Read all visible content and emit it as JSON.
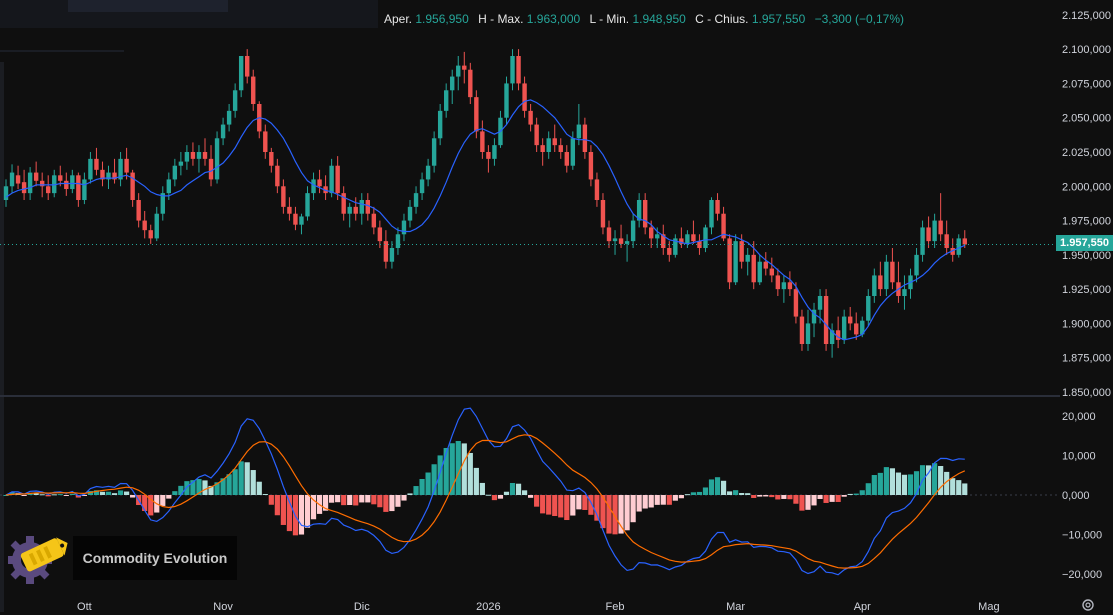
{
  "header": {
    "open_label": "Aper.",
    "open_value": "1.956,950",
    "high_label": "H - Max.",
    "high_value": "1.963,000",
    "low_label": "L - Min.",
    "low_value": "1.948,950",
    "close_label": "C - Chius.",
    "close_value": "1.957,550",
    "change_value": "−3,300 (−0,17%)"
  },
  "brand": {
    "name": "Commodity Evolution"
  },
  "last_price_label": "1.957,550",
  "colors": {
    "background": "#0f0f0f",
    "up": "#26a69a",
    "down": "#ef5350",
    "ma": "#2962ff",
    "macd": "#2962ff",
    "signal": "#ff6d00",
    "hist_up_strong": "#26a69a",
    "hist_up_weak": "#b2dfdb",
    "hist_down_strong": "#ef5350",
    "hist_down_weak": "#ffcdd2",
    "text": "#d1d4dc",
    "grid": "#2a2e39"
  },
  "icons": {
    "logo": "commodity-tag-gear-icon",
    "settings": "gear-icon"
  },
  "chart_data": [
    {
      "type": "candlestick",
      "y_ticks": [
        "2.125,000",
        "2.100,000",
        "2.075,000",
        "2.050,000",
        "2.025,000",
        "2.000,000",
        "1.975,000",
        "1.950,000",
        "1.925,000",
        "1.900,000",
        "1.875,000",
        "1.850,000"
      ],
      "ylim": [
        1850,
        2130
      ],
      "x_ticks": [
        "Ott",
        "Nov",
        "Dic",
        "2026",
        "Feb",
        "Mar",
        "Apr",
        "Mag"
      ],
      "x_tick_index": [
        13,
        36,
        59,
        80,
        101,
        121,
        142,
        163
      ],
      "last_price": 1957.55,
      "candles": [
        [
          1990,
          2005,
          1985,
          2000
        ],
        [
          2000,
          2016,
          1995,
          2010
        ],
        [
          2008,
          2015,
          1998,
          2002
        ],
        [
          2003,
          2012,
          1990,
          1995
        ],
        [
          1995,
          2014,
          1990,
          2010
        ],
        [
          2010,
          2018,
          2000,
          2004
        ],
        [
          2004,
          2010,
          1992,
          2000
        ],
        [
          2000,
          2008,
          1990,
          1995
        ],
        [
          1995,
          2012,
          1992,
          2008
        ],
        [
          2008,
          2015,
          2000,
          2004
        ],
        [
          2004,
          2010,
          1993,
          1998
        ],
        [
          1998,
          2012,
          1995,
          2008
        ],
        [
          2008,
          2010,
          1985,
          1990
        ],
        [
          1990,
          2010,
          1987,
          2005
        ],
        [
          2005,
          2025,
          2002,
          2020
        ],
        [
          2020,
          2028,
          2008,
          2012
        ],
        [
          2012,
          2018,
          2000,
          2005
        ],
        [
          2005,
          2015,
          1998,
          2010
        ],
        [
          2010,
          2020,
          2002,
          2005
        ],
        [
          2005,
          2025,
          2000,
          2020
        ],
        [
          2020,
          2028,
          2005,
          2010
        ],
        [
          2010,
          2012,
          1985,
          1990
        ],
        [
          1990,
          1995,
          1970,
          1975
        ],
        [
          1975,
          1982,
          1962,
          1968
        ],
        [
          1968,
          1972,
          1958,
          1962
        ],
        [
          1962,
          1985,
          1960,
          1980
        ],
        [
          1980,
          2000,
          1975,
          1995
        ],
        [
          1995,
          2010,
          1990,
          2005
        ],
        [
          2005,
          2020,
          2000,
          2015
        ],
        [
          2015,
          2025,
          2008,
          2018
        ],
        [
          2018,
          2030,
          2012,
          2025
        ],
        [
          2025,
          2032,
          2015,
          2020
        ],
        [
          2020,
          2030,
          2010,
          2025
        ],
        [
          2025,
          2035,
          2015,
          2020
        ],
        [
          2020,
          2030,
          2000,
          2005
        ],
        [
          2005,
          2040,
          2002,
          2035
        ],
        [
          2035,
          2050,
          2030,
          2045
        ],
        [
          2045,
          2060,
          2040,
          2055
        ],
        [
          2055,
          2075,
          2050,
          2070
        ],
        [
          2070,
          2090,
          2065,
          2095
        ],
        [
          2095,
          2100,
          2075,
          2080
        ],
        [
          2080,
          2085,
          2055,
          2060
        ],
        [
          2060,
          2062,
          2035,
          2040
        ],
        [
          2040,
          2045,
          2020,
          2025
        ],
        [
          2025,
          2028,
          2010,
          2015
        ],
        [
          2015,
          2020,
          1995,
          2000
        ],
        [
          2000,
          2005,
          1980,
          1985
        ],
        [
          1985,
          1992,
          1975,
          1980
        ],
        [
          1980,
          1985,
          1968,
          1972
        ],
        [
          1972,
          1980,
          1965,
          1978
        ],
        [
          1978,
          2000,
          1975,
          1995
        ],
        [
          1995,
          2010,
          1990,
          2005
        ],
        [
          2005,
          2012,
          1995,
          2000
        ],
        [
          2000,
          2008,
          1990,
          1995
        ],
        [
          1995,
          2020,
          1992,
          2015
        ],
        [
          2015,
          2022,
          1990,
          1995
        ],
        [
          1995,
          2000,
          1975,
          1980
        ],
        [
          1980,
          1988,
          1970,
          1985
        ],
        [
          1985,
          1992,
          1975,
          1980
        ],
        [
          1980,
          1995,
          1972,
          1990
        ],
        [
          1990,
          1995,
          1975,
          1980
        ],
        [
          1980,
          1985,
          1965,
          1970
        ],
        [
          1970,
          1975,
          1955,
          1960
        ],
        [
          1960,
          1968,
          1940,
          1945
        ],
        [
          1945,
          1960,
          1940,
          1955
        ],
        [
          1955,
          1970,
          1950,
          1965
        ],
        [
          1965,
          1980,
          1960,
          1975
        ],
        [
          1975,
          1990,
          1970,
          1985
        ],
        [
          1985,
          2000,
          1980,
          1995
        ],
        [
          1995,
          2010,
          1990,
          2005
        ],
        [
          2005,
          2020,
          2000,
          2015
        ],
        [
          2015,
          2040,
          2010,
          2035
        ],
        [
          2035,
          2060,
          2030,
          2055
        ],
        [
          2055,
          2075,
          2050,
          2070
        ],
        [
          2070,
          2085,
          2060,
          2080
        ],
        [
          2080,
          2095,
          2070,
          2088
        ],
        [
          2088,
          2098,
          2075,
          2085
        ],
        [
          2085,
          2090,
          2060,
          2065
        ],
        [
          2065,
          2070,
          2035,
          2040
        ],
        [
          2040,
          2048,
          2020,
          2025
        ],
        [
          2025,
          2030,
          2010,
          2020
        ],
        [
          2020,
          2035,
          2015,
          2030
        ],
        [
          2030,
          2055,
          2028,
          2050
        ],
        [
          2050,
          2080,
          2045,
          2075
        ],
        [
          2075,
          2100,
          2070,
          2095
        ],
        [
          2095,
          2100,
          2070,
          2075
        ],
        [
          2075,
          2080,
          2050,
          2055
        ],
        [
          2055,
          2060,
          2040,
          2045
        ],
        [
          2045,
          2050,
          2025,
          2030
        ],
        [
          2030,
          2035,
          2015,
          2025
        ],
        [
          2025,
          2040,
          2020,
          2035
        ],
        [
          2035,
          2045,
          2025,
          2030
        ],
        [
          2030,
          2035,
          2020,
          2025
        ],
        [
          2025,
          2030,
          2010,
          2015
        ],
        [
          2015,
          2040,
          2012,
          2035
        ],
        [
          2035,
          2060,
          2030,
          2045
        ],
        [
          2045,
          2050,
          2020,
          2025
        ],
        [
          2025,
          2030,
          2000,
          2005
        ],
        [
          2005,
          2010,
          1985,
          1990
        ],
        [
          1990,
          1995,
          1965,
          1970
        ],
        [
          1970,
          1975,
          1955,
          1960
        ],
        [
          1960,
          1968,
          1950,
          1962
        ],
        [
          1962,
          1972,
          1955,
          1958
        ],
        [
          1958,
          1965,
          1945,
          1960
        ],
        [
          1960,
          1980,
          1955,
          1975
        ],
        [
          1975,
          1995,
          1970,
          1990
        ],
        [
          1990,
          1995,
          1965,
          1970
        ],
        [
          1970,
          1975,
          1955,
          1962
        ],
        [
          1962,
          1970,
          1955,
          1965
        ],
        [
          1965,
          1972,
          1950,
          1955
        ],
        [
          1955,
          1960,
          1945,
          1950
        ],
        [
          1950,
          1965,
          1948,
          1962
        ],
        [
          1962,
          1970,
          1955,
          1958
        ],
        [
          1958,
          1968,
          1955,
          1965
        ],
        [
          1965,
          1975,
          1958,
          1960
        ],
        [
          1960,
          1965,
          1950,
          1955
        ],
        [
          1955,
          1972,
          1952,
          1970
        ],
        [
          1970,
          1992,
          1965,
          1990
        ],
        [
          1990,
          1995,
          1975,
          1980
        ],
        [
          1980,
          1985,
          1960,
          1962
        ],
        [
          1962,
          1965,
          1925,
          1930
        ],
        [
          1930,
          1965,
          1928,
          1960
        ],
        [
          1960,
          1965,
          1940,
          1945
        ],
        [
          1945,
          1955,
          1935,
          1950
        ],
        [
          1950,
          1960,
          1925,
          1930
        ],
        [
          1930,
          1950,
          1928,
          1945
        ],
        [
          1945,
          1952,
          1935,
          1940
        ],
        [
          1940,
          1948,
          1930,
          1935
        ],
        [
          1935,
          1940,
          1920,
          1925
        ],
        [
          1925,
          1935,
          1915,
          1930
        ],
        [
          1930,
          1938,
          1920,
          1925
        ],
        [
          1925,
          1930,
          1900,
          1905
        ],
        [
          1905,
          1910,
          1880,
          1885
        ],
        [
          1885,
          1910,
          1880,
          1900
        ],
        [
          1900,
          1915,
          1890,
          1910
        ],
        [
          1910,
          1925,
          1900,
          1920
        ],
        [
          1920,
          1925,
          1880,
          1885
        ],
        [
          1885,
          1900,
          1875,
          1895
        ],
        [
          1895,
          1905,
          1882,
          1888
        ],
        [
          1888,
          1910,
          1885,
          1905
        ],
        [
          1905,
          1912,
          1895,
          1900
        ],
        [
          1900,
          1908,
          1888,
          1892
        ],
        [
          1892,
          1905,
          1890,
          1902
        ],
        [
          1902,
          1925,
          1898,
          1920
        ],
        [
          1920,
          1940,
          1915,
          1935
        ],
        [
          1935,
          1945,
          1920,
          1925
        ],
        [
          1925,
          1950,
          1920,
          1945
        ],
        [
          1945,
          1955,
          1925,
          1930
        ],
        [
          1930,
          1945,
          1915,
          1920
        ],
        [
          1920,
          1935,
          1910,
          1925
        ],
        [
          1925,
          1940,
          1918,
          1935
        ],
        [
          1935,
          1955,
          1930,
          1950
        ],
        [
          1950,
          1975,
          1945,
          1970
        ],
        [
          1970,
          1978,
          1955,
          1960
        ],
        [
          1960,
          1980,
          1955,
          1975
        ],
        [
          1975,
          1995,
          1960,
          1965
        ],
        [
          1965,
          1975,
          1950,
          1955
        ],
        [
          1955,
          1962,
          1945,
          1950
        ],
        [
          1950,
          1965,
          1948,
          1962
        ],
        [
          1962,
          1968,
          1955,
          1957.55
        ]
      ],
      "moving_average": [
        1992,
        1995,
        1997,
        1998,
        1999,
        2001,
        2001,
        2001,
        2001,
        2002,
        2002,
        2002,
        2002,
        2001,
        2003,
        2005,
        2006,
        2006,
        2006,
        2007,
        2008,
        2006,
        2003,
        2000,
        1996,
        1994,
        1993,
        1993,
        1995,
        1997,
        2001,
        2004,
        2007,
        2010,
        2011,
        2014,
        2017,
        2022,
        2028,
        2036,
        2043,
        2048,
        2050,
        2049,
        2046,
        2041,
        2035,
        2027,
        2018,
        2010,
        2004,
        2001,
        1999,
        1997,
        1996,
        1994,
        1992,
        1990,
        1988,
        1987,
        1986,
        1984,
        1981,
        1976,
        1971,
        1968,
        1967,
        1967,
        1969,
        1972,
        1977,
        1984,
        1993,
        2003,
        2014,
        2024,
        2032,
        2038,
        2041,
        2042,
        2040,
        2038,
        2040,
        2045,
        2052,
        2058,
        2062,
        2063,
        2061,
        2058,
        2054,
        2050,
        2044,
        2038,
        2035,
        2034,
        2034,
        2033,
        2029,
        2023,
        2015,
        2006,
        1996,
        1987,
        1980,
        1976,
        1975,
        1972,
        1967,
        1964,
        1961,
        1960,
        1959,
        1958,
        1959,
        1960,
        1961,
        1961,
        1963,
        1965,
        1964,
        1963,
        1961,
        1959,
        1955,
        1950,
        1946,
        1943,
        1939,
        1935,
        1932,
        1927,
        1919,
        1912,
        1907,
        1904,
        1899,
        1894,
        1890,
        1888,
        1889,
        1890,
        1892,
        1898,
        1906,
        1913,
        1918,
        1922,
        1925,
        1928,
        1930,
        1932,
        1935,
        1939,
        1944,
        1948,
        1951,
        1953,
        1955,
        1957
      ]
    },
    {
      "type": "macd",
      "y_ticks": [
        "20,000",
        "10,000",
        "0,000",
        "−10,000",
        "−20,000"
      ],
      "ylim": [
        -24000,
        24000
      ],
      "x_ticks": [
        "Ott",
        "Nov",
        "Dic",
        "2026",
        "Feb",
        "Mar",
        "Apr",
        "Mag"
      ]
    }
  ]
}
